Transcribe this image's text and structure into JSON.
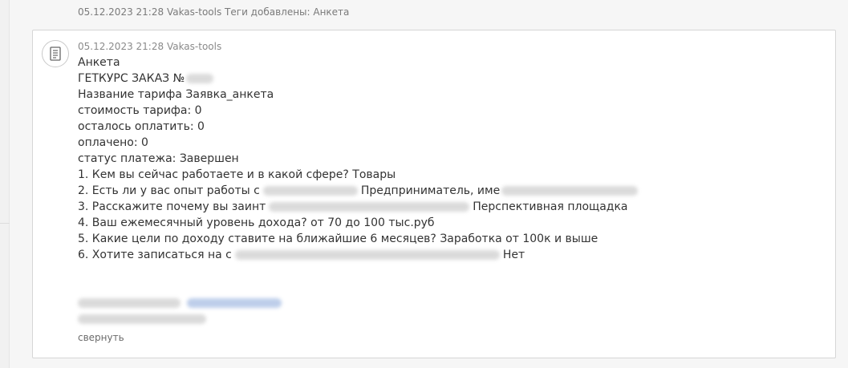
{
  "event": {
    "timestamp": "05.12.2023 21:28",
    "author": "Vakas-tools",
    "text": "Теги добавлены: Анкета"
  },
  "message": {
    "timestamp": "05.12.2023 21:28",
    "author": "Vakas-tools",
    "icon": "document-icon",
    "lines": [
      {
        "pre": "Анкета",
        "post": ""
      },
      {
        "pre": "ГЕТКУРС ЗАКАЗ №",
        "post": ""
      },
      {
        "pre": "Название тарифа Заявка_анкета",
        "post": ""
      },
      {
        "pre": "стоимость тарифа: 0",
        "post": ""
      },
      {
        "pre": "осталось оплатить: 0",
        "post": ""
      },
      {
        "pre": "оплачено: 0",
        "post": ""
      },
      {
        "pre": "статус платежа: Завершен",
        "post": ""
      },
      {
        "pre": "1. Кем вы сейчас работаете и в какой сфере? Товары",
        "post": ""
      },
      {
        "pre": "2. Есть ли у вас опыт работы с",
        "post": "Предприниматель, име"
      },
      {
        "pre": "3. Расскажите почему вы заинт",
        "post": "Перспективная площадка"
      },
      {
        "pre": "4. Ваш ежемесячный уровень дохода? от 70 до 100 тыс.руб",
        "post": ""
      },
      {
        "pre": "5. Какие цели по доходу ставите на ближайшие 6 месяцев? Заработка от 100к и выше",
        "post": ""
      },
      {
        "pre": "6. Хотите записаться на с",
        "post": "Нет"
      }
    ]
  },
  "collapse_label": "свернуть"
}
